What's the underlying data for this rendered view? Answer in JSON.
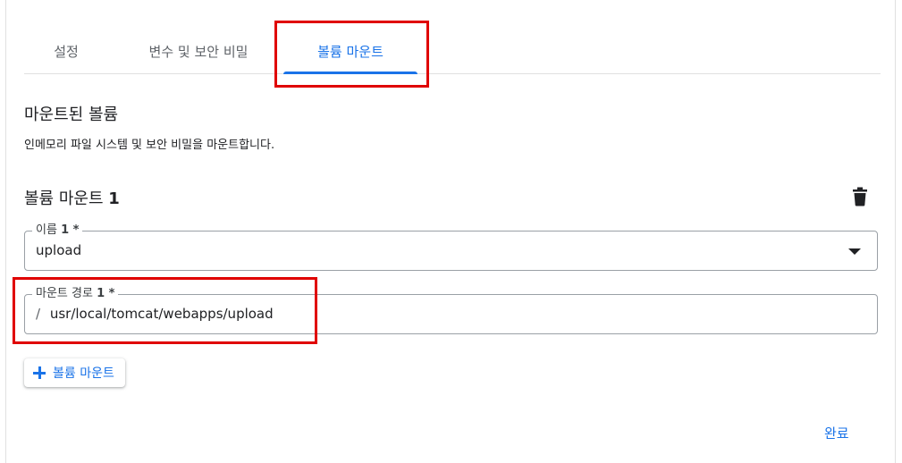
{
  "tabs": [
    {
      "label": "설정"
    },
    {
      "label": "변수 및 보안 비밀"
    },
    {
      "label": "볼륨 마운트",
      "active": true
    }
  ],
  "section": {
    "title": "마운트된 볼륨",
    "description": "인메모리 파일 시스템 및 보안 비밀을 마운트합니다."
  },
  "volume_mount": {
    "title": "볼륨 마운트",
    "title_number": "1",
    "delete_icon": "trash-icon",
    "name_field": {
      "label": "이름",
      "label_suffix": "1 *",
      "value": "upload"
    },
    "path_field": {
      "label": "마운트 경로",
      "label_suffix": "1 *",
      "prefix": "/",
      "value": "usr/local/tomcat/webapps/upload"
    }
  },
  "add_button": {
    "label": "볼륨 마운트",
    "icon": "plus-icon"
  },
  "done_button": {
    "label": "완료"
  },
  "colors": {
    "accent": "#1a73e8",
    "highlight": "#e00000"
  }
}
